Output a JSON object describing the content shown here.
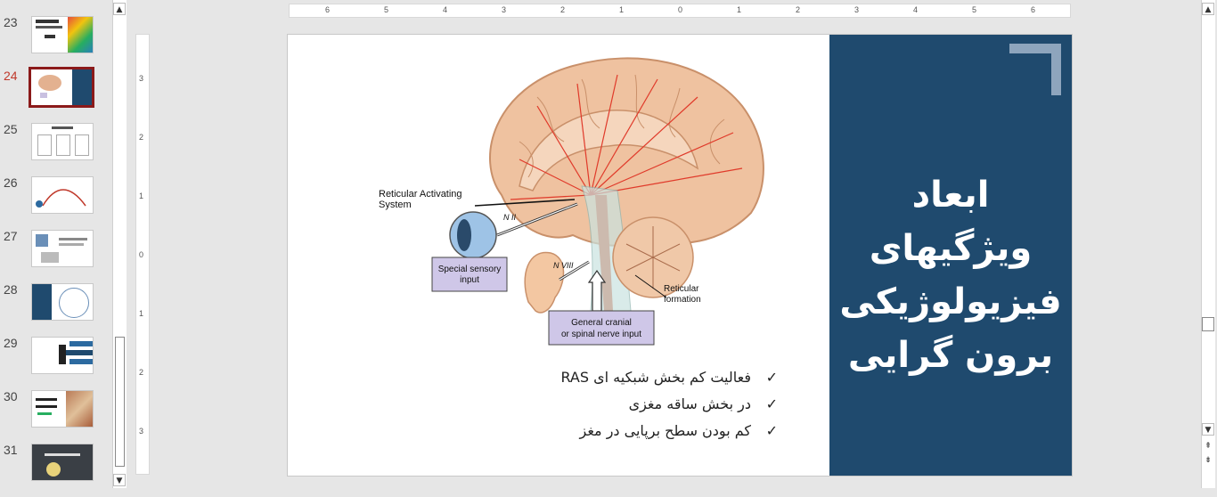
{
  "thumbnails": [
    {
      "num": "23",
      "selected": false
    },
    {
      "num": "24",
      "selected": true
    },
    {
      "num": "25",
      "selected": false
    },
    {
      "num": "26",
      "selected": false
    },
    {
      "num": "27",
      "selected": false
    },
    {
      "num": "28",
      "selected": false
    },
    {
      "num": "29",
      "selected": false
    },
    {
      "num": "30",
      "selected": false
    },
    {
      "num": "31",
      "selected": false
    }
  ],
  "ruler": {
    "h_labels": [
      "6",
      "5",
      "4",
      "3",
      "2",
      "1",
      "0",
      "1",
      "2",
      "3",
      "4",
      "5",
      "6"
    ],
    "v_labels": [
      "3",
      "2",
      "1",
      "0",
      "1",
      "2",
      "3"
    ]
  },
  "slide": {
    "title_lines": [
      "ابعاد ویژگیهای",
      "فیزیولوژیکی",
      "برون گرایی"
    ],
    "figure": {
      "label_ras": [
        "Reticular Activating",
        "System"
      ],
      "label_n2": "N II",
      "label_n8": "N VIII",
      "label_special": [
        "Special sensory",
        "input"
      ],
      "label_general": [
        "General cranial",
        "or spinal nerve input"
      ],
      "label_reticular": [
        "Reticular",
        "formation"
      ]
    },
    "bullets": [
      "فعالیت کم بخش شبکیه ای RAS",
      "در بخش ساقه مغزی",
      "کم بودن سطح برپایی در مغز"
    ],
    "check_glyph": "✓"
  },
  "colors": {
    "panel": "#1f4a6e",
    "accent_frame": "#8ea5bd",
    "selected_border": "#8b1a1a"
  }
}
